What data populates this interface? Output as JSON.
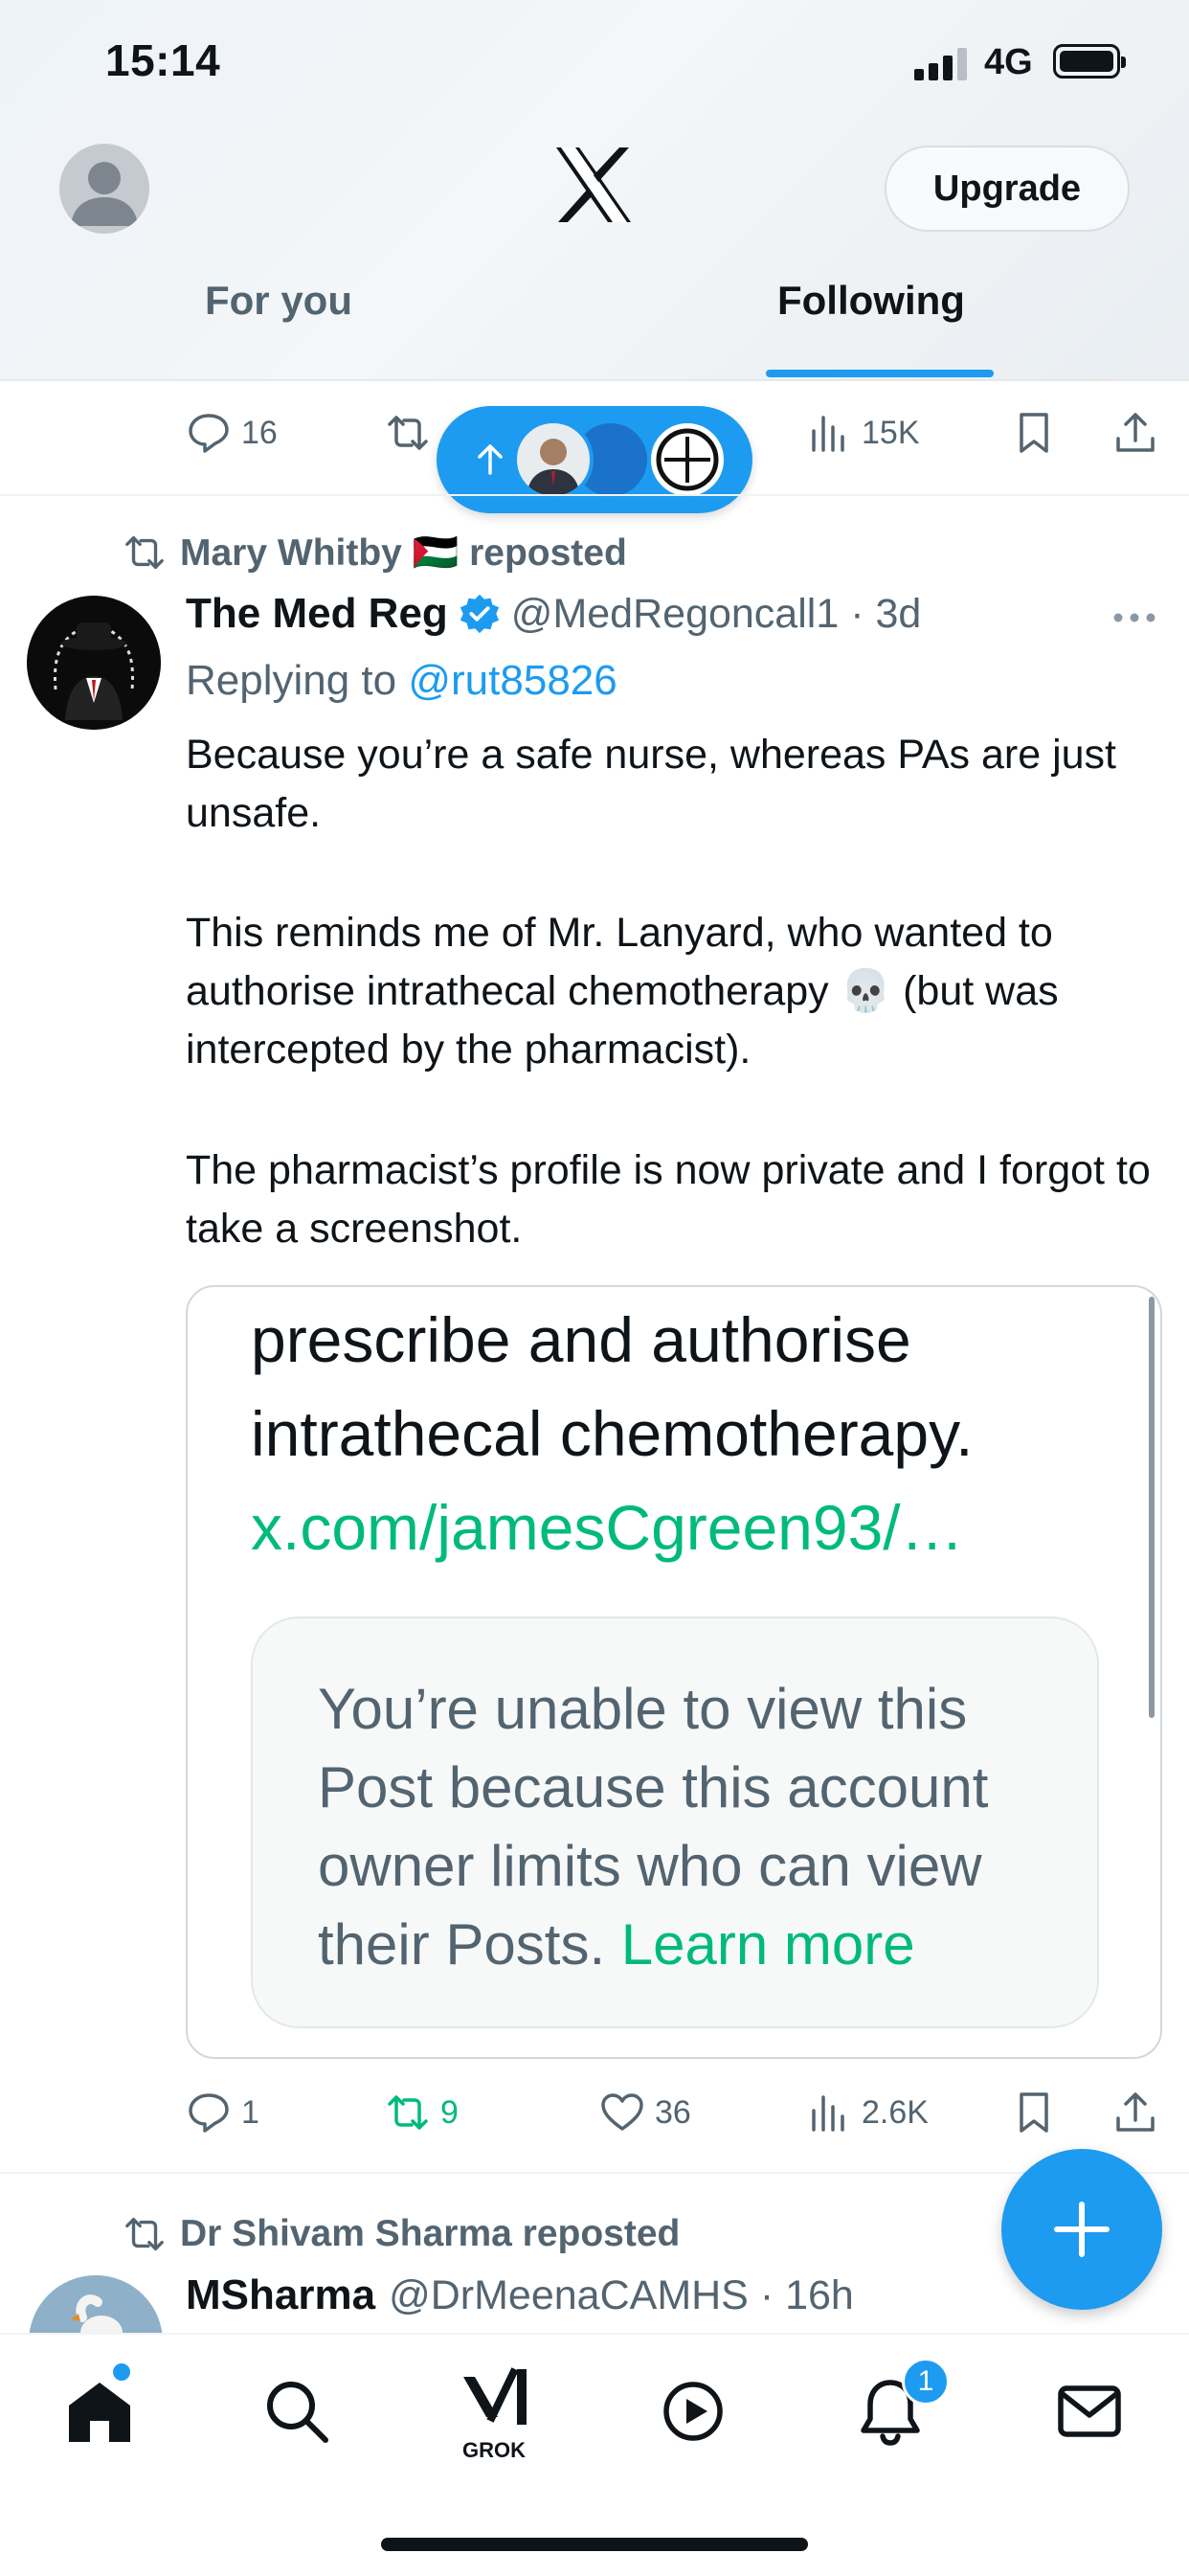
{
  "status_bar": {
    "time": "15:14",
    "network": "4G"
  },
  "header": {
    "upgrade_label": "Upgrade",
    "tabs": [
      {
        "label": "For you"
      },
      {
        "label": "Following"
      }
    ]
  },
  "prev_post_actions": {
    "replies": "16",
    "views": "15K"
  },
  "post": {
    "repost_by": "Mary Whitby 🇵🇸 reposted",
    "author_name": "The Med Reg",
    "author_handle": "@MedRegoncall1",
    "separator": " · ",
    "time": "3d",
    "replying_prefix": "Replying to ",
    "replying_handle": "@rut85826",
    "paragraphs": [
      "Because you’re a safe nurse, whereas PAs are just unsafe.",
      "This reminds me of Mr. Lanyard, who wanted to authorise intrathecal chemotherapy 💀 (but was intercepted by the pharmacist).",
      "The pharmacist’s profile is now private and I forgot to take a screenshot."
    ],
    "embed": {
      "line1": "prescribe and authorise",
      "line2": "intrathecal chemotherapy.",
      "link": "x.com/jamesCgreen93/…",
      "notice": "You’re unable to view this Post because this account owner limits who can view their Posts.",
      "learn_more": "Learn more"
    },
    "actions": {
      "replies": "1",
      "reposts": "9",
      "likes": "36",
      "views": "2.6K"
    }
  },
  "next_post": {
    "repost_by": "Dr Shivam Sharma reposted",
    "author_name": "MSharma",
    "author_handle": "@DrMeenaCAMHS",
    "separator": " · ",
    "time": "16h"
  },
  "bottom_nav": {
    "grok_label": "GROK",
    "notifications_count": "1"
  },
  "colors": {
    "accent": "#1d9bf0",
    "repost_green": "#00ba7c",
    "secondary_text": "#536471"
  }
}
